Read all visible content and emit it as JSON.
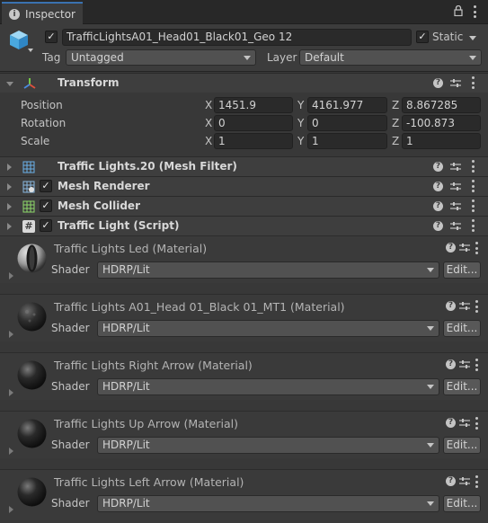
{
  "window": {
    "tab_label": "Inspector"
  },
  "object": {
    "enabled": true,
    "name": "TrafficLightsA01_Head01_Black01_Geo 12",
    "static_label": "Static",
    "static_checked": true,
    "tag_label": "Tag",
    "tag_value": "Untagged",
    "layer_label": "Layer",
    "layer_value": "Default"
  },
  "transform": {
    "title": "Transform",
    "rows": [
      {
        "label": "Position",
        "x": "1451.9",
        "y": "4161.977",
        "z": "8.867285"
      },
      {
        "label": "Rotation",
        "x": "0",
        "y": "0",
        "z": "-100.873"
      },
      {
        "label": "Scale",
        "x": "1",
        "y": "1",
        "z": "1"
      }
    ],
    "axis": {
      "x": "X",
      "y": "Y",
      "z": "Z"
    }
  },
  "components": [
    {
      "title": "Traffic Lights.20 (Mesh Filter)",
      "checkbox": false
    },
    {
      "title": "Mesh Renderer",
      "checkbox": true
    },
    {
      "title": "Mesh Collider",
      "checkbox": true
    },
    {
      "title": "Traffic Light (Script)",
      "checkbox": true
    }
  ],
  "materials": [
    {
      "title": "Traffic Lights Led (Material)",
      "shader_label": "Shader",
      "shader_value": "HDRP/Lit",
      "edit_label": "Edit..."
    },
    {
      "title": "Traffic Lights A01_Head 01_Black 01_MT1 (Material)",
      "shader_label": "Shader",
      "shader_value": "HDRP/Lit",
      "edit_label": "Edit..."
    },
    {
      "title": "Traffic Lights Right Arrow (Material)",
      "shader_label": "Shader",
      "shader_value": "HDRP/Lit",
      "edit_label": "Edit..."
    },
    {
      "title": "Traffic Lights Up Arrow (Material)",
      "shader_label": "Shader",
      "shader_value": "HDRP/Lit",
      "edit_label": "Edit..."
    },
    {
      "title": "Traffic Lights Left Arrow (Material)",
      "shader_label": "Shader",
      "shader_value": "HDRP/Lit",
      "edit_label": "Edit..."
    }
  ],
  "colors": {
    "accent": "#3a72b0",
    "panel": "#383838",
    "field": "#2a2a2a"
  }
}
